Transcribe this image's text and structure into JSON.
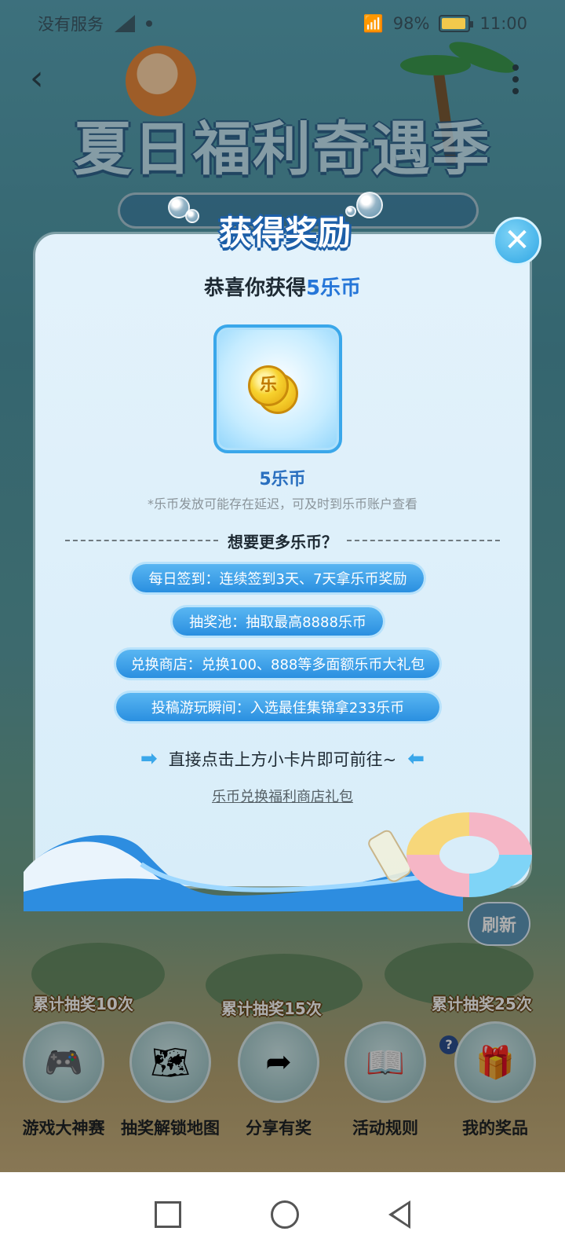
{
  "status_bar": {
    "carrier": "没有服务",
    "wifi_battery": "98%",
    "time": "11:00"
  },
  "page": {
    "title": "夏日福利奇遇季",
    "refresh_label": "刷新",
    "islands": [
      {
        "label": "累计抽奖10次"
      },
      {
        "label": "累计抽奖15次"
      },
      {
        "label": "累计抽奖25次"
      }
    ],
    "features": [
      {
        "label": "游戏大神赛",
        "icon": "game-master-icon"
      },
      {
        "label": "抽奖解锁地图",
        "icon": "map-icon"
      },
      {
        "label": "分享有奖",
        "icon": "share-icon"
      },
      {
        "label": "活动规则",
        "icon": "rules-book-icon"
      },
      {
        "label": "我的奖品",
        "icon": "gift-icon"
      }
    ]
  },
  "modal": {
    "title": "获得奖励",
    "congrats_prefix": "恭喜你获得",
    "congrats_highlight": "5乐币",
    "reward_name": "5乐币",
    "reward_note": "*乐币发放可能存在延迟，可及时到乐币账户查看",
    "divider_text": "想要更多乐币？",
    "coin_glyph": "乐",
    "options": [
      {
        "label": "每日签到：连续签到3天、7天拿乐币奖励"
      },
      {
        "label": "抽奖池：抽取最高8888乐币"
      },
      {
        "label": "兑换商店：兑换100、888等多面额乐币大礼包"
      },
      {
        "label": "投稿游玩瞬间：入选最佳集锦拿233乐币"
      }
    ],
    "hint": "直接点击上方小卡片即可前往~",
    "link": "乐币兑换福利商店礼包"
  },
  "colors": {
    "accent": "#2576d8",
    "pill": "#2a8fe0",
    "coin": "#f7d22e"
  }
}
